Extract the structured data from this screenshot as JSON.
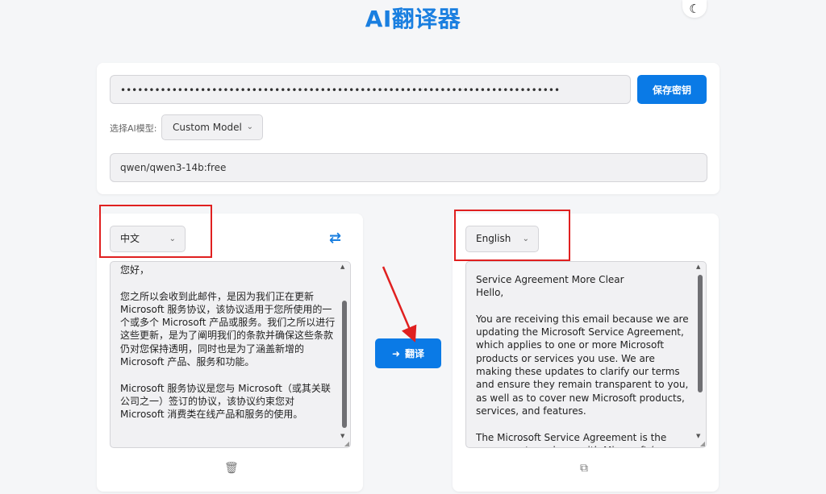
{
  "header": {
    "title": "AI翻译器",
    "theme_toggle_icon": "moon-icon"
  },
  "settings": {
    "api_key_value": "•••••••••••••••••••••••••••••••••••••••••••••••••••••••••••••••••••••••••••••",
    "save_key_label": "保存密钥",
    "model_label": "选择AI模型:",
    "model_selected": "Custom Model",
    "model_name_value": "qwen/qwen3-14b:free"
  },
  "source": {
    "language": "中文",
    "paragraphs": [
      "您好，",
      "您之所以会收到此邮件，是因为我们正在更新 Microsoft 服务协议，该协议适用于您所使用的一个或多个 Microsoft 产品或服务。我们之所以进行这些更新，是为了阐明我们的条款并确保这些条款仍对您保持透明，同时也是为了涵盖新增的 Microsoft 产品、服务和功能。",
      "Microsoft 服务协议是您与 Microsoft（或其关联公司之一）签订的协议，该协议约束您对 Microsoft 消费类在线产品和服务的使用。"
    ],
    "clear_icon": "trash-icon"
  },
  "swap_icon": "swap-arrows-icon",
  "translate_label": "翻译",
  "target": {
    "language": "English",
    "lines": [
      "Service Agreement More Clear",
      "Hello,"
    ],
    "paragraphs": [
      "You are receiving this email because we are updating the Microsoft Service Agreement, which applies to one or more Microsoft products or services you use. We are making these updates to clarify our terms and ensure they remain transparent to you, as well as to cover new Microsoft products, services, and features.",
      "The Microsoft Service Agreement is the agreement you have with Microsoft (or one of its affiliates)"
    ],
    "copy_icon": "copy-icon"
  },
  "colors": {
    "accent": "#0a7ae6",
    "annotation": "#e02020"
  }
}
